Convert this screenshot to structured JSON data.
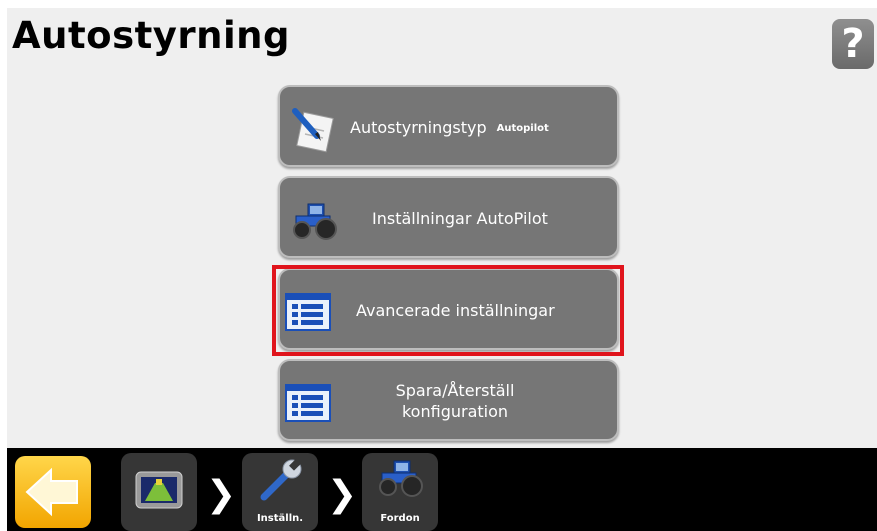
{
  "header": {
    "title": "Autostyrning",
    "help_label": "?"
  },
  "menu": {
    "items": [
      {
        "label": "Autostyrningstyp",
        "value": "Autopilot",
        "icon": "notepad-pencil-icon"
      },
      {
        "label": "Inställningar AutoPilot",
        "icon": "tractor-icon"
      },
      {
        "label": "Avancerade inställningar",
        "icon": "list-icon",
        "highlighted": true
      },
      {
        "label_line1": "Spara/Återställ",
        "label_line2": "konfiguration",
        "icon": "list-icon"
      }
    ]
  },
  "nav": {
    "back_icon": "back-arrow-icon",
    "crumbs": [
      {
        "label": "",
        "icon": "display-icon"
      },
      {
        "label": "Inställn.",
        "icon": "wrench-icon"
      },
      {
        "label": "Fordon",
        "icon": "tractor-icon"
      }
    ]
  },
  "colors": {
    "highlight": "#e0141c",
    "button": "#767676",
    "back": "#f5b800"
  }
}
